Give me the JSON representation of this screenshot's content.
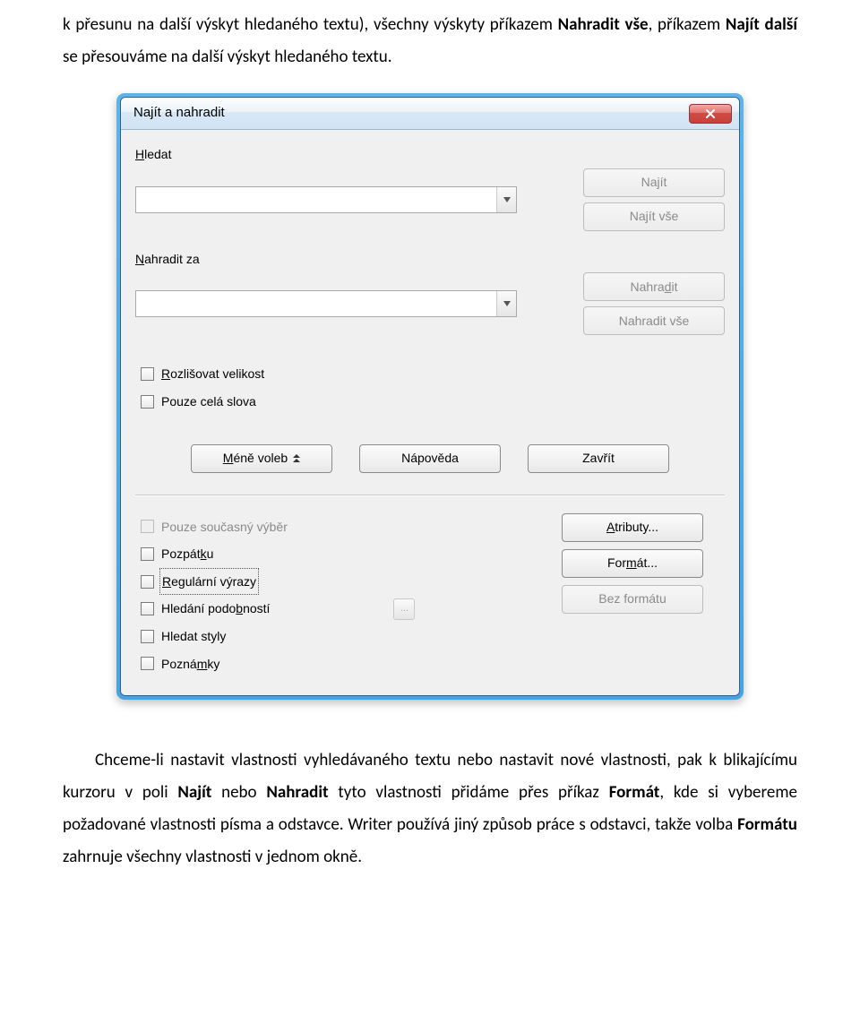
{
  "para1_a": "k přesunu na další výskyt hledaného textu), všechny výskyty příkazem ",
  "para1_b": "Nahradit vše",
  "para1_c": ", příkazem ",
  "para1_d": "Najít další",
  "para1_e": " se přesouváme na další výskyt hledaného textu.",
  "para2_a": "Chceme-li nastavit vlastnosti vyhledávaného textu nebo nastavit nové vlastnosti, pak k blikajícímu kurzoru v poli ",
  "para2_b": "Najít",
  "para2_c": " nebo ",
  "para2_d": "Nahradit",
  "para2_e": " tyto vlastnosti přidáme přes příkaz ",
  "para2_f": "Formát",
  "para2_g": ", kde si vybereme požadované vlastnosti písma a odstavce. Writer používá jiný způsob práce s odstavci, takže volba ",
  "para2_h": "Formátu",
  "para2_i": " zahrnuje všechny vlastnosti v jednom okně.",
  "dlg": {
    "title": "Najít a nahradit",
    "find_label_pre": "H",
    "find_label_post": "ledat",
    "replace_label_pre": "N",
    "replace_label_post": "ahradit za",
    "btn_find": "Najít",
    "btn_findall": "Najít vše",
    "btn_replace_pre": "Nahra",
    "btn_replace_mid": "d",
    "btn_replace_post": "it",
    "btn_replaceall": "Nahradit vše",
    "chk_case_pre": "R",
    "chk_case_post": "ozlišovat velikost",
    "chk_whole": "Pouze celá slova",
    "btn_less_pre": "M",
    "btn_less_post": "éně voleb",
    "btn_help": "Nápověda",
    "btn_close": "Zavřít",
    "chk_sel": "Pouze současný výběr",
    "chk_back_pre": "Pozpát",
    "chk_back_mid": "k",
    "chk_back_post": "u",
    "chk_regex_pre": "R",
    "chk_regex_post": "egulární výrazy",
    "chk_sim_pre": "Hledání podo",
    "chk_sim_mid": "b",
    "chk_sim_post": "ností",
    "chk_styles": "Hledat styly",
    "chk_notes_pre": "Pozná",
    "chk_notes_mid": "m",
    "chk_notes_post": "ky",
    "btn_attr_pre": "A",
    "btn_attr_post": "tributy...",
    "btn_format_pre": "For",
    "btn_format_mid": "m",
    "btn_format_post": "át...",
    "btn_noformat": "Bez formátu",
    "ellipsis": "..."
  }
}
